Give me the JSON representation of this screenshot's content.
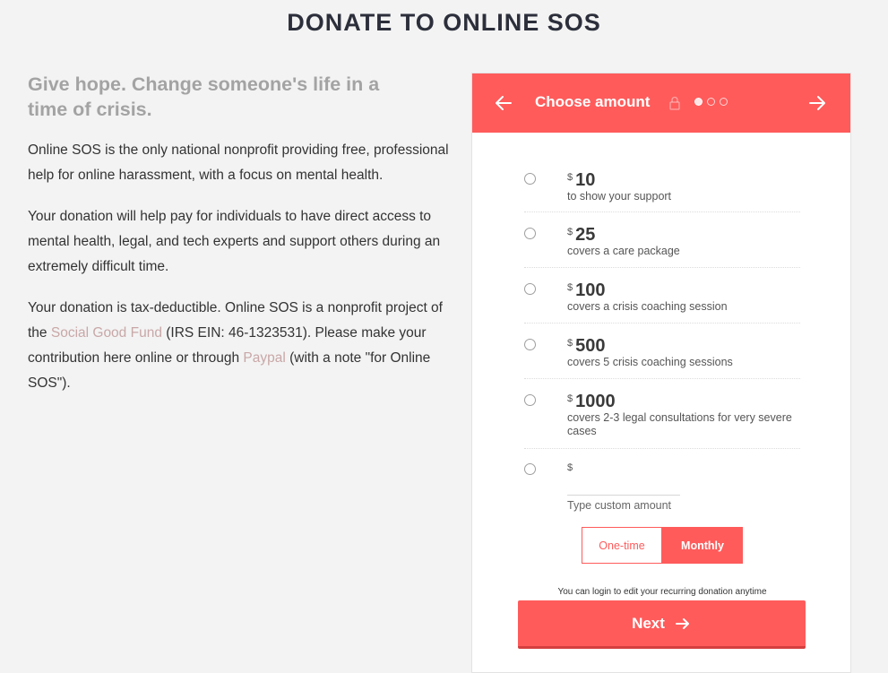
{
  "page": {
    "title": "DONATE TO ONLINE SOS"
  },
  "left": {
    "tagline": "Give hope. Change someone's life in a time of crisis.",
    "para1": "Online SOS is the only national nonprofit providing free, professional help for online harassment, with a focus on mental health.",
    "para2": "Your donation will help pay for individuals to have direct access to mental health, legal, and tech experts and support others during an extremely difficult time.",
    "para3": {
      "text_a": "Your donation is tax-deductible. Online SOS is a nonprofit project of the ",
      "link1": "Social Good Fund",
      "text_b": " (IRS EIN: 46-1323531). Please make your contribution here online or through ",
      "link2": "Paypal",
      "text_c": " (with a note \"for Online SOS\")."
    }
  },
  "widget": {
    "header": {
      "title": "Choose amount",
      "back_icon": "arrow-left-icon",
      "lock_icon": "lock-icon",
      "next_icon": "arrow-right-icon",
      "step_current": 1,
      "step_total": 3
    },
    "currency": "$",
    "options": [
      {
        "amount": "10",
        "description": "to show your support"
      },
      {
        "amount": "25",
        "description": "covers a care package"
      },
      {
        "amount": "100",
        "description": "covers a crisis coaching session"
      },
      {
        "amount": "500",
        "description": "covers 5 crisis coaching sessions"
      },
      {
        "amount": "1000",
        "description": "covers 2-3 legal consultations for very severe cases"
      }
    ],
    "custom_placeholder": "Type custom amount",
    "frequency": {
      "one_time": "One-time",
      "monthly": "Monthly",
      "selected": "Monthly"
    },
    "note": "You can login to edit your recurring donation anytime",
    "next_label": "Next"
  },
  "colors": {
    "accent": "#ff5b5b",
    "link": "#c9a7a7",
    "tagline": "#a3a3a3"
  }
}
